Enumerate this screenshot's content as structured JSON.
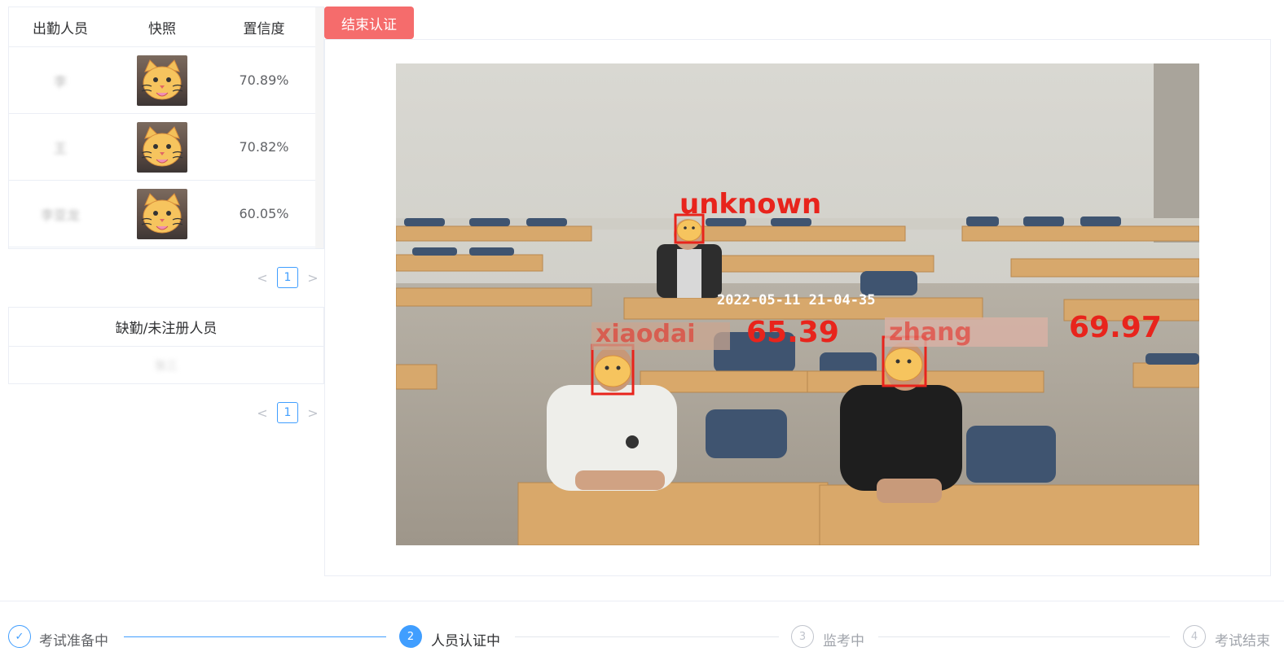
{
  "attendance_table": {
    "headers": [
      "出勤人员",
      "快照",
      "置信度"
    ],
    "rows": [
      {
        "name": "李",
        "confidence": "70.89%"
      },
      {
        "name": "王",
        "confidence": "70.82%"
      },
      {
        "name": "李亚龙",
        "confidence": "60.05%"
      }
    ]
  },
  "pager1": {
    "prev": "<",
    "page": "1",
    "next": ">"
  },
  "absent_table": {
    "header": "缺勤/未注册人员",
    "rows": [
      "张三"
    ]
  },
  "pager2": {
    "prev": "<",
    "page": "1",
    "next": ">"
  },
  "end_button": "结束认证",
  "video": {
    "timestamp": "2022-05-11 21-04-35",
    "labels": [
      {
        "text": "unknown"
      },
      {
        "text": "65.39",
        "name": "xiaodai"
      },
      {
        "text": "69.97",
        "name": "zhang"
      }
    ]
  },
  "steps": [
    {
      "index": "✓",
      "title": "考试准备中",
      "status": "finished"
    },
    {
      "index": "2",
      "title": "人员认证中",
      "status": "process"
    },
    {
      "index": "3",
      "title": "监考中",
      "status": "wait"
    },
    {
      "index": "4",
      "title": "考试结束",
      "status": "wait"
    }
  ],
  "colors": {
    "primary": "#409eff",
    "danger": "#f56c6c",
    "muted": "#c0c4cc",
    "detect": "#e8241c"
  }
}
